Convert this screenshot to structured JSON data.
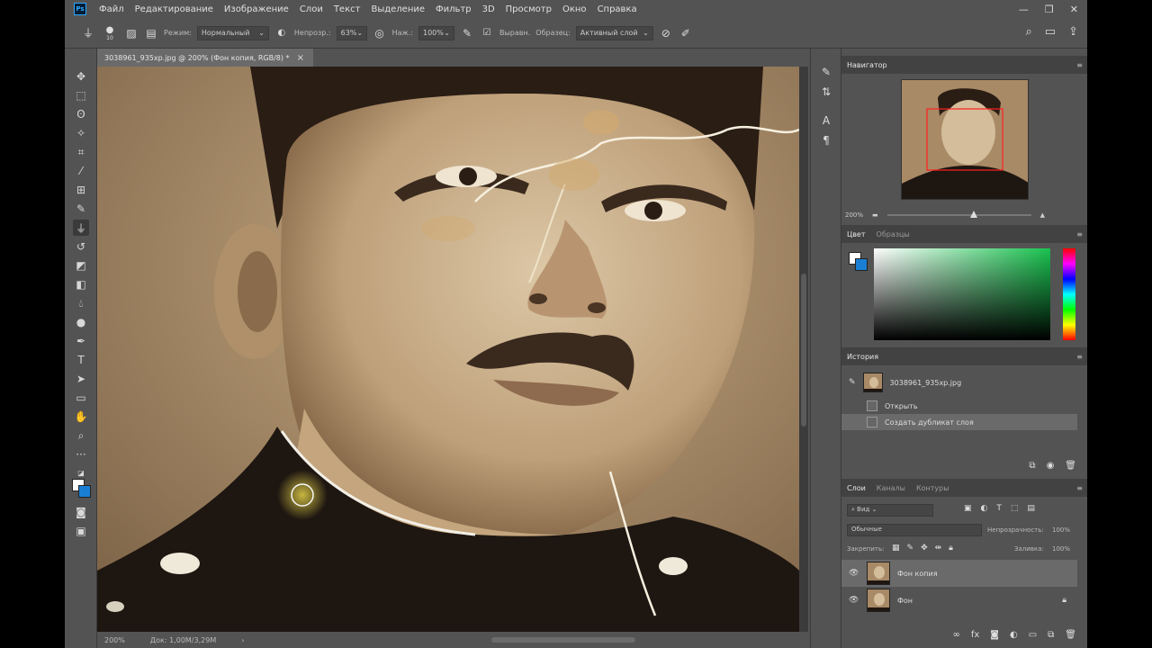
{
  "menu": {
    "logo": "Ps",
    "items": [
      "Файл",
      "Редактирование",
      "Изображение",
      "Слои",
      "Текст",
      "Выделение",
      "Фильтр",
      "3D",
      "Просмотр",
      "Окно",
      "Справка"
    ],
    "window_controls": [
      "—",
      "❐",
      "✕"
    ]
  },
  "options": {
    "brush_size": "10",
    "mode_label": "Режим:",
    "mode_value": "Нормальный",
    "opacity_label": "Непрозр.:",
    "opacity_value": "63%",
    "flow_label": "Наж.:",
    "flow_value": "100%",
    "aligned_label": "Выравн.",
    "sample_label": "Образец:",
    "sample_value": "Активный слой"
  },
  "document": {
    "tab_title": "3038961_935xp.jpg @ 200% (Фон копия, RGB/8) *",
    "zoom": "200%",
    "doc_size": "Док: 1,00M/3,29M"
  },
  "navigator": {
    "tab": "Навигатор",
    "zoom": "200%"
  },
  "color": {
    "tabs": [
      "Цвет",
      "Образцы"
    ]
  },
  "history": {
    "tab": "История",
    "snapshot": "3038961_935xp.jpg",
    "items": [
      "Открыть",
      "Создать дубликат слоя"
    ]
  },
  "layers": {
    "tabs": [
      "Слои",
      "Каналы",
      "Контуры"
    ],
    "filter": "Вид",
    "blend": "Обычные",
    "opacity_label": "Непрозрачность:",
    "opacity_value": "100%",
    "lock_label": "Закрепить:",
    "fill_label": "Заливка:",
    "fill_value": "100%",
    "items": [
      "Фон копия",
      "Фон"
    ]
  },
  "colors": {
    "accent": "#31a8ff",
    "background_swatch": "#1a7fd4",
    "nav_box": "#ff2020"
  }
}
